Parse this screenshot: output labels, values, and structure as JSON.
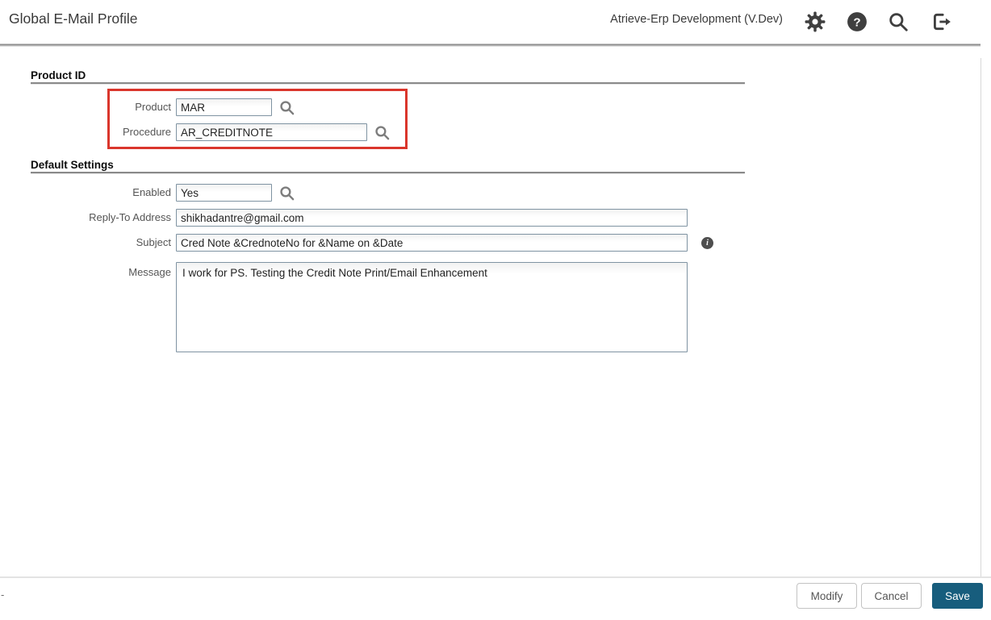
{
  "app": {
    "title": "Global E-Mail Profile",
    "environment": "Atrieve-Erp Development (V.Dev)"
  },
  "header_icons": [
    {
      "name": "settings-gear"
    },
    {
      "name": "help"
    },
    {
      "name": "search"
    },
    {
      "name": "logout"
    }
  ],
  "sections": {
    "product_id": {
      "title": "Product ID"
    },
    "default_settings": {
      "title": "Default Settings"
    }
  },
  "fields": {
    "product": {
      "label": "Product",
      "value": "MAR"
    },
    "procedure": {
      "label": "Procedure",
      "value": "AR_CREDITNOTE"
    },
    "enabled": {
      "label": "Enabled",
      "value": "Yes"
    },
    "reply_to": {
      "label": "Reply-To Address",
      "value": "shikhadantre@gmail.com"
    },
    "subject": {
      "label": "Subject",
      "value": "Cred Note &CrednoteNo for &Name on &Date"
    },
    "message": {
      "label": "Message",
      "value": "I work for PS. Testing the Credit Note Print/Email Enhancement"
    }
  },
  "footer": {
    "left_mark": "-",
    "buttons": [
      {
        "label": "Modify"
      },
      {
        "label": "Cancel"
      },
      {
        "label": "Save"
      }
    ]
  },
  "colors": {
    "save_button": "#175d7d",
    "annotation_box": "#da362c",
    "input_border": "#7f93a2",
    "icon": "#3f3f3f"
  }
}
